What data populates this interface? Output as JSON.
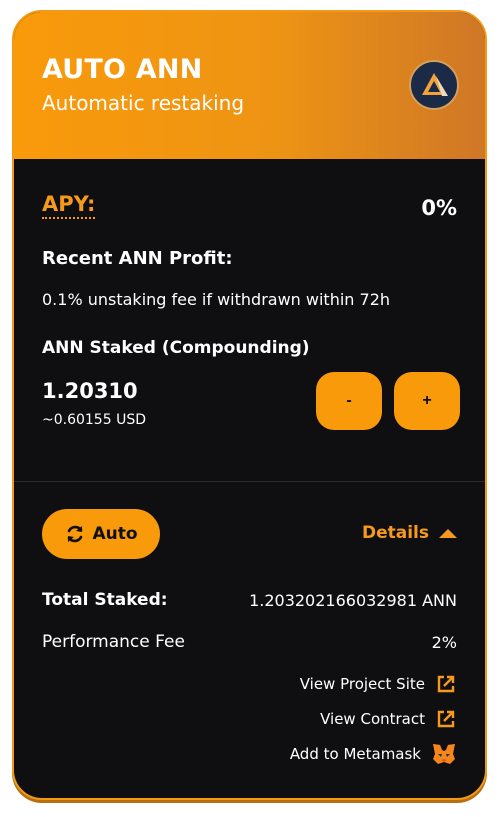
{
  "header": {
    "title": "AUTO ANN",
    "subtitle": "Automatic restaking",
    "logo_icon": "ann-token-logo"
  },
  "apy": {
    "label": "APY:",
    "value": "0%"
  },
  "profit": {
    "label": "Recent ANN Profit:",
    "fee_note": "0.1% unstaking fee if withdrawn within 72h"
  },
  "staked": {
    "label": "ANN Staked (Compounding)",
    "amount": "1.20310",
    "usd": "~0.60155 USD",
    "minus_label": "-",
    "plus_label": "+"
  },
  "footer": {
    "auto_label": "Auto",
    "auto_icon": "sync-icon",
    "details_label": "Details",
    "total_staked_label": "Total Staked:",
    "total_staked_value": "1.203202166032981 ANN",
    "performance_fee_label": "Performance Fee",
    "performance_fee_value": "2%",
    "links": {
      "project_site": "View Project Site",
      "contract": "View Contract",
      "metamask": "Add to Metamask"
    }
  },
  "colors": {
    "accent": "#f99a0b",
    "header_gradient_end": "#cf7727",
    "card_bg": "#0f0f12",
    "text": "#ffffff"
  }
}
